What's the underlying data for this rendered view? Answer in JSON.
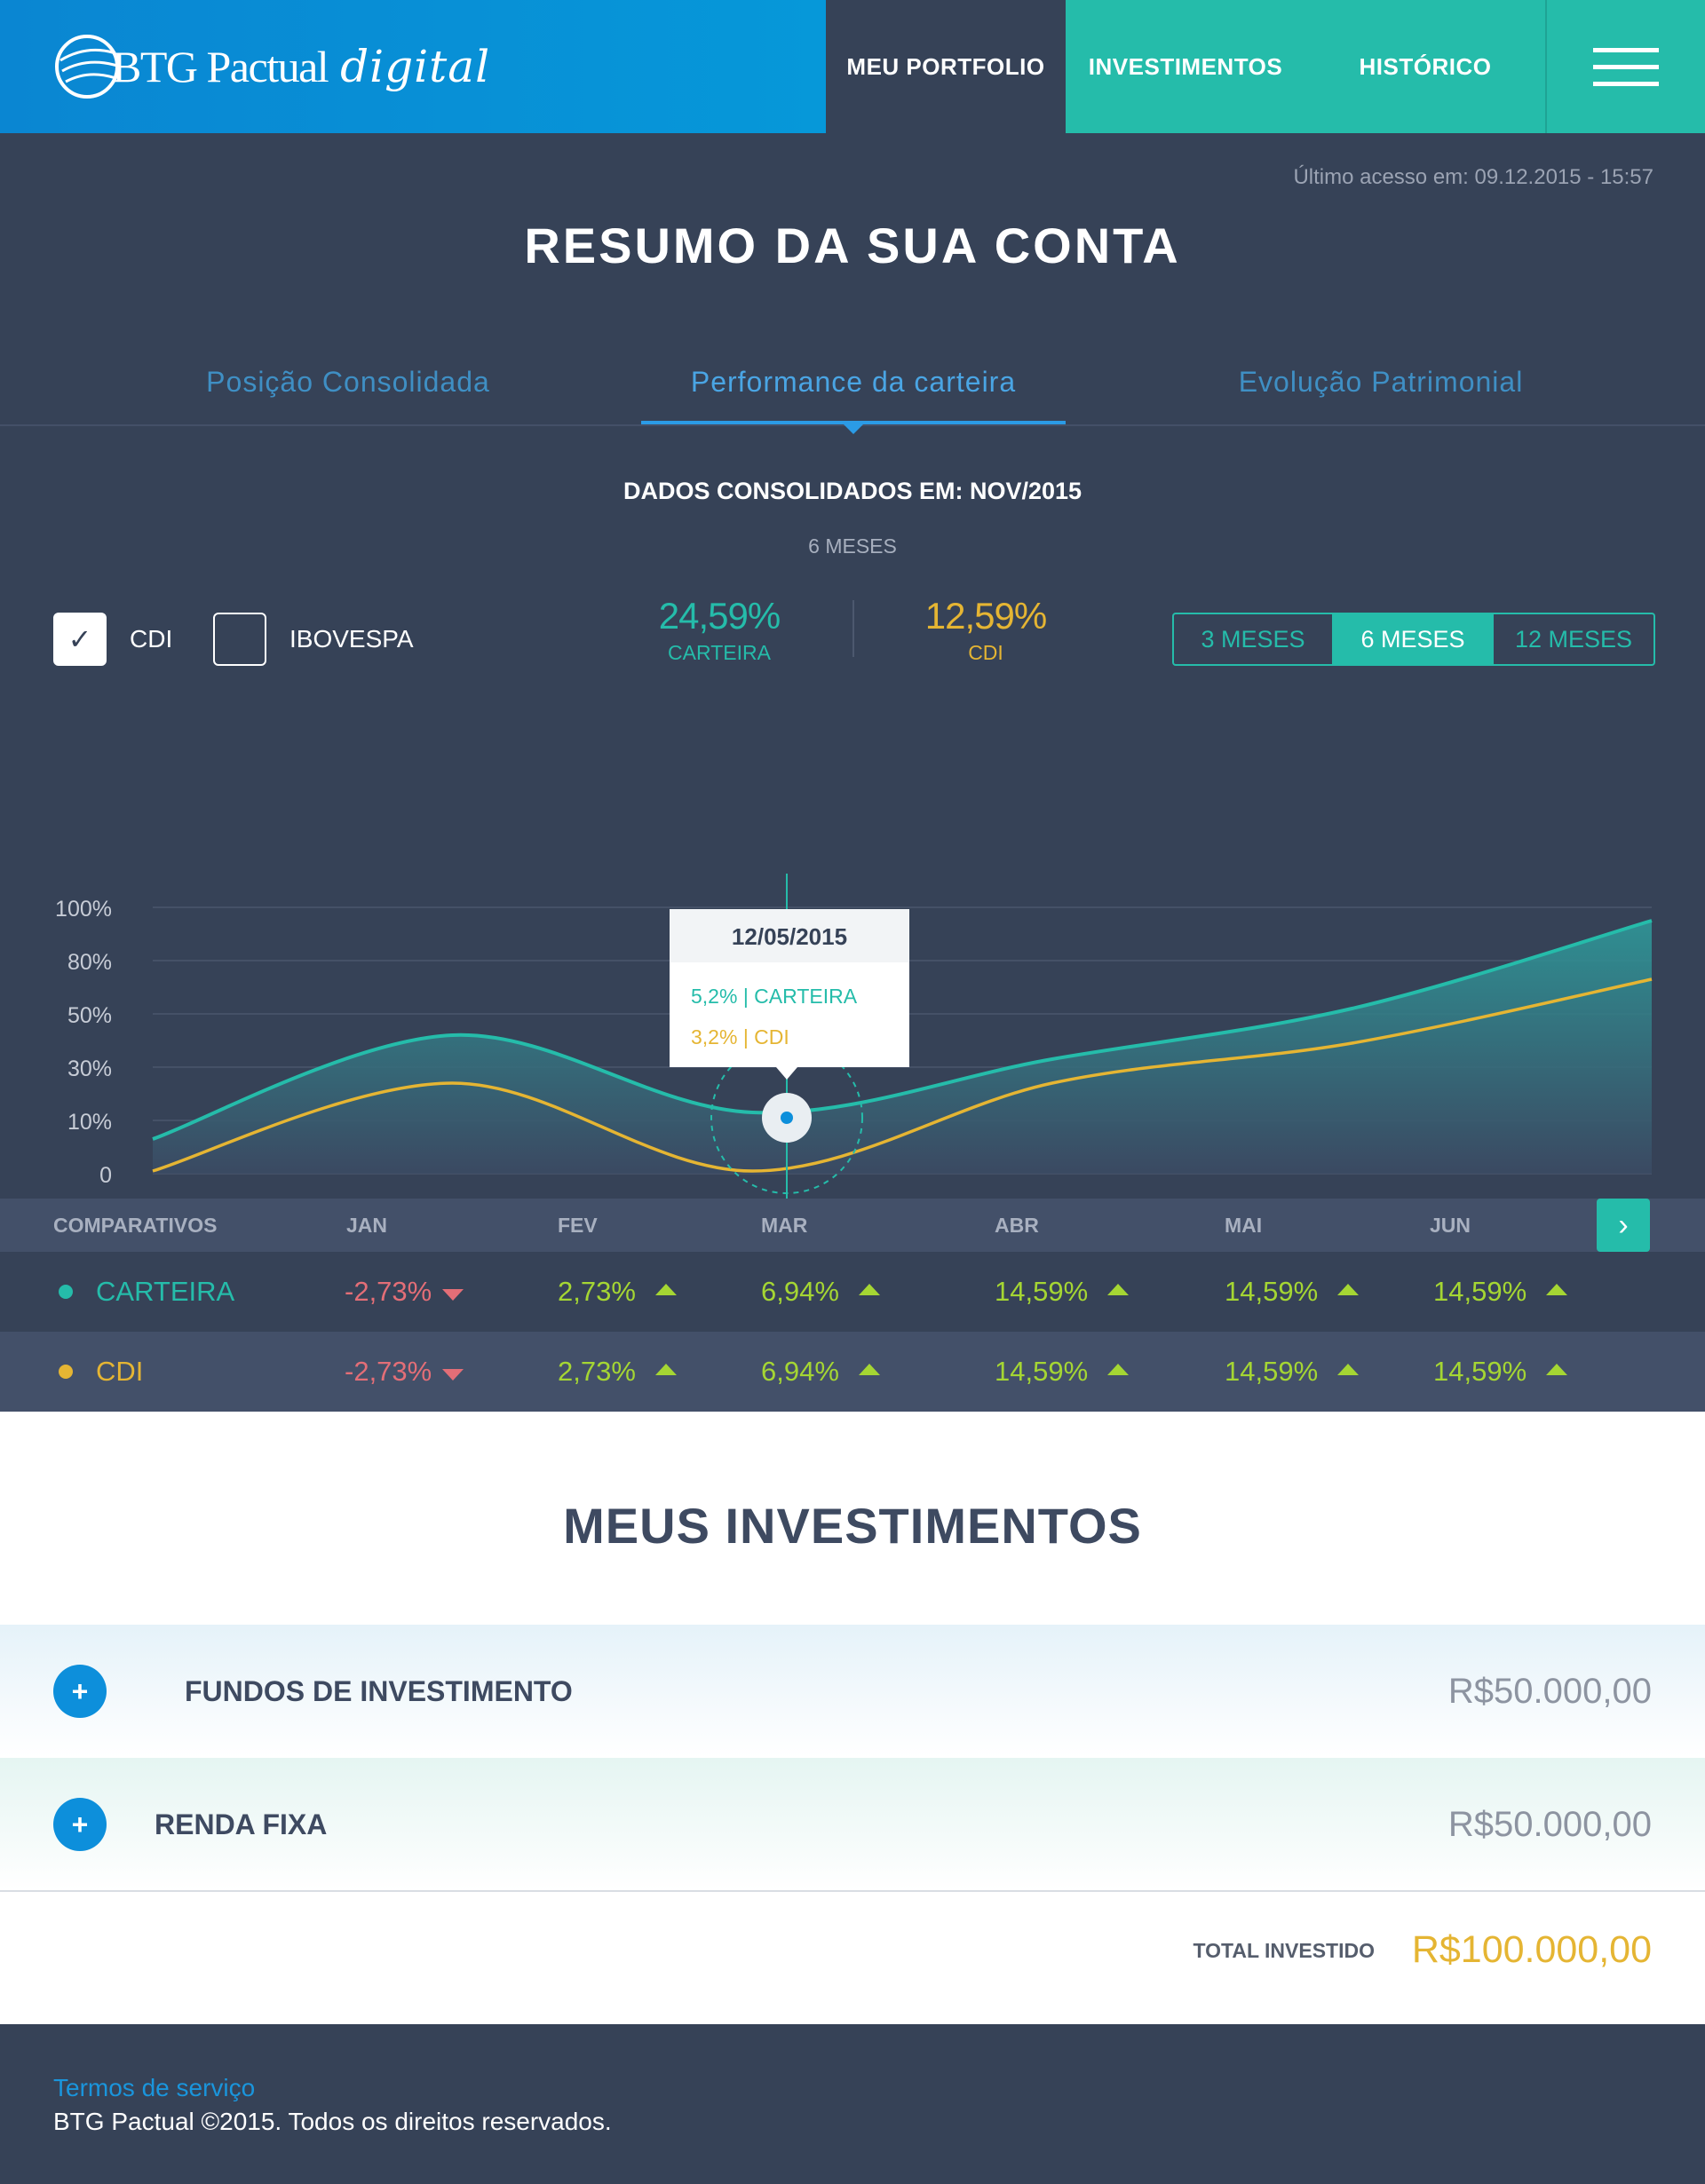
{
  "header": {
    "logo_word": "BTG Pactual",
    "logo_script": "digital",
    "nav": [
      "MEU PORTFOLIO",
      "INVESTIMENTOS",
      "HISTÓRICO"
    ]
  },
  "summary": {
    "last_access": "Último acesso em: 09.12.2015 - 15:57",
    "title": "RESUMO DA SUA CONTA",
    "tabs": [
      "Posição Consolidada",
      "Performance da carteira",
      "Evolução Patrimonial"
    ],
    "active_tab": "Performance da carteira",
    "consolidated": "DADOS CONSOLIDADOS EM: NOV/2015",
    "period_label": "6 MESES",
    "checkboxes": [
      {
        "label": "CDI",
        "checked": true
      },
      {
        "label": "IBOVESPA",
        "checked": false
      }
    ],
    "stats": [
      {
        "value": "24,59%",
        "label": "CARTEIRA"
      },
      {
        "value": "12,59%",
        "label": "CDI"
      }
    ],
    "periods": [
      "3 MESES",
      "6 MESES",
      "12 MESES"
    ],
    "active_period": "6 MESES"
  },
  "chart_data": {
    "type": "area",
    "x": [
      "JAN",
      "FEV",
      "MAR",
      "ABR",
      "MAI",
      "JUN"
    ],
    "y_ticks": [
      "100%",
      "80%",
      "50%",
      "30%",
      "10%",
      "0"
    ],
    "series": [
      {
        "name": "CARTEIRA",
        "color": "#25bcaa",
        "values": [
          13,
          52,
          23,
          43,
          62,
          95
        ]
      },
      {
        "name": "CDI",
        "color": "#e5b533",
        "values": [
          1,
          34,
          1,
          34,
          49,
          73
        ]
      }
    ],
    "tooltip": {
      "date": "12/05/2015",
      "lines": [
        {
          "value": "5,2%",
          "series": "CARTEIRA"
        },
        {
          "value": "3,2%",
          "series": "CDI"
        }
      ]
    },
    "grid": true
  },
  "comparativos": {
    "label": "COMPARATIVOS",
    "months": [
      "JAN",
      "FEV",
      "MAR",
      "ABR",
      "MAI",
      "JUN"
    ],
    "rows": [
      {
        "name": "CARTEIRA",
        "color": "#25bcaa",
        "values": [
          "-2,73%",
          "2,73%",
          "6,94%",
          "14,59%",
          "14,59%",
          "14,59%"
        ],
        "directions": [
          "down",
          "up",
          "up",
          "up",
          "up",
          "up"
        ]
      },
      {
        "name": "CDI",
        "color": "#e5b533",
        "values": [
          "-2,73%",
          "2,73%",
          "6,94%",
          "14,59%",
          "14,59%",
          "14,59%"
        ],
        "directions": [
          "down",
          "up",
          "up",
          "up",
          "up",
          "up"
        ]
      }
    ],
    "next_icon": "chevron-right-icon"
  },
  "investments": {
    "title": "MEUS INVESTIMENTOS",
    "items": [
      {
        "name": "FUNDOS DE INVESTIMENTO",
        "amount": "R$50.000,00"
      },
      {
        "name": "RENDA FIXA",
        "amount": "R$50.000,00"
      }
    ],
    "total_label": "TOTAL INVESTIDO",
    "total_value": "R$100.000,00"
  },
  "footer": {
    "terms": "Termos de serviço",
    "copyright": "BTG Pactual ©2015. Todos os direitos reservados."
  },
  "colors": {
    "header_blue": "#0a86d2",
    "teal": "#25bcaa",
    "dark": "#364257",
    "gold": "#e5b533",
    "green": "#a5d633",
    "red": "#e36e77"
  }
}
